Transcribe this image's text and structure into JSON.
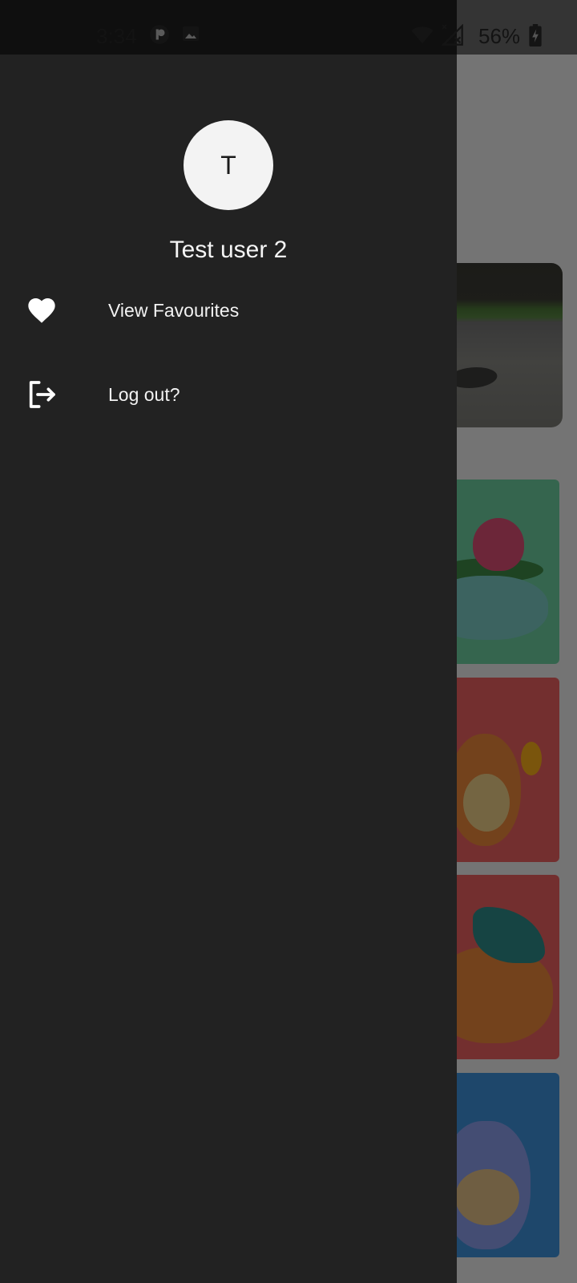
{
  "status_bar": {
    "time": "3:34",
    "icons": [
      "app-notification-icon",
      "image-notification-icon",
      "wifi-icon",
      "no-signal-icon",
      "battery-charging-icon"
    ],
    "battery_percent": "56%"
  },
  "drawer": {
    "avatar_initial": "T",
    "user_name": "Test user 2",
    "items": [
      {
        "label": "View Favourites",
        "icon": "heart-icon"
      },
      {
        "label": "Log out?",
        "icon": "logout-icon"
      }
    ]
  },
  "colors": {
    "drawer_bg": "#222222",
    "avatar_bg": "#f3f3f3",
    "card_green": "#6fd3a4",
    "card_red": "#f06363",
    "card_blue": "#3f95e0"
  }
}
